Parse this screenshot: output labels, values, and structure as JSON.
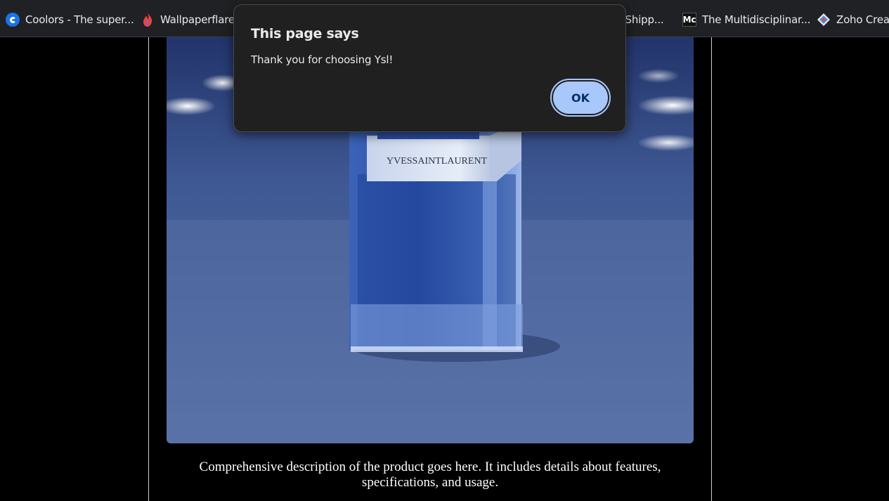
{
  "bookmarks": [
    {
      "label": "Coolors - The super...",
      "icon": "coolors-icon"
    },
    {
      "label": "Wallpaperflare -",
      "icon": "flame-icon"
    },
    {
      "label": "o Shipp...",
      "icon": ""
    },
    {
      "label": "The Multidisciplinar...",
      "icon": "mc-icon",
      "icon_text": "Mc"
    },
    {
      "label": "Zoho Creat",
      "icon": "zoho-diamond-icon"
    }
  ],
  "dialog": {
    "title": "This page says",
    "message": "Thank you for choosing Ysl!",
    "ok_label": "OK"
  },
  "product": {
    "brand_text": "YVESSAINTLAURENT",
    "description": "Comprehensive description of the product goes here. It includes details about features, specifications, and usage."
  },
  "colors": {
    "accent": "#a8c7fa",
    "dialog_bg": "#202020",
    "bookmarks_bg": "#202124"
  }
}
